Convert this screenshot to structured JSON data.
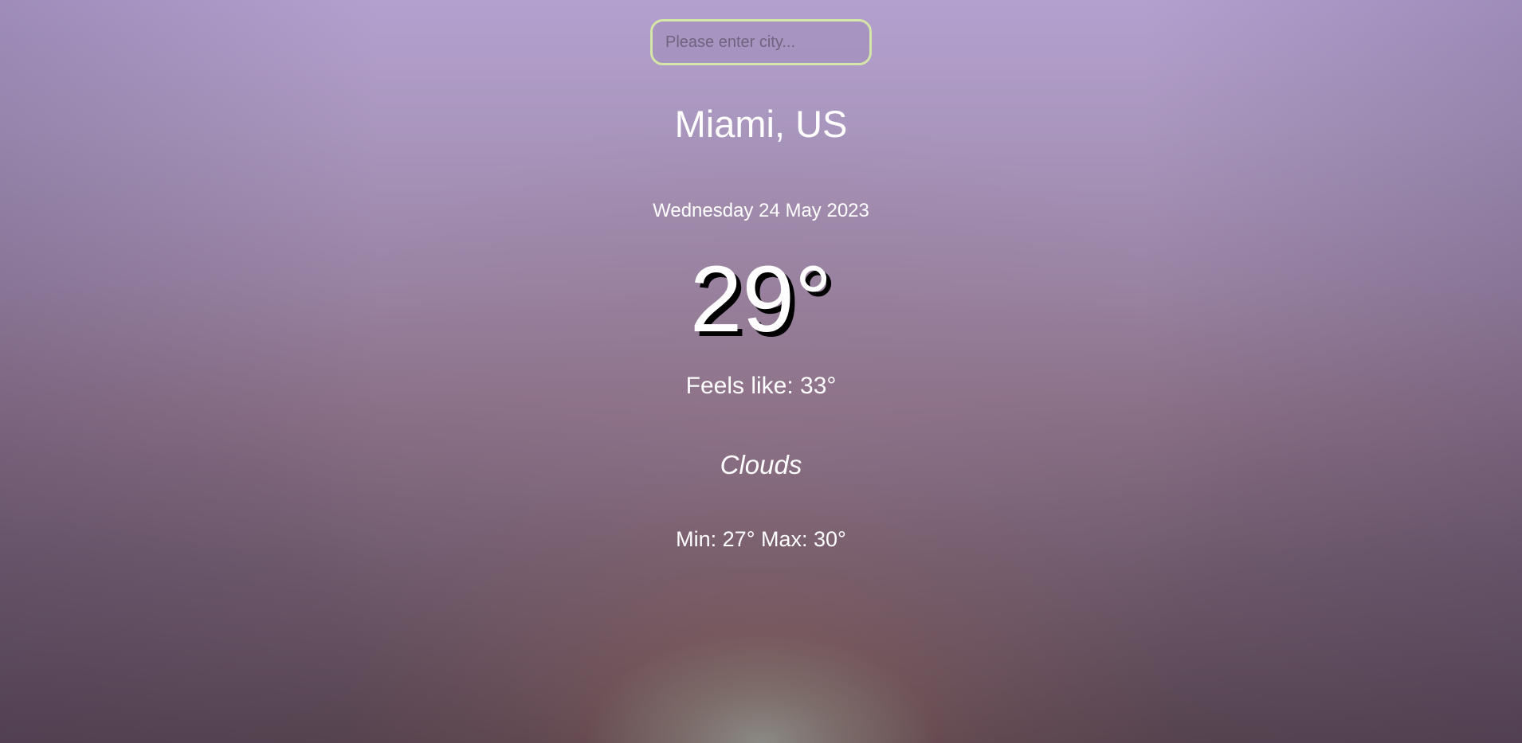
{
  "search": {
    "placeholder": "Please enter city...",
    "value": ""
  },
  "weather": {
    "location": "Miami, US",
    "date": "Wednesday 24 May 2023",
    "temperature": "29°",
    "feels_like": "Feels like: 33°",
    "description": "Clouds",
    "min_max": "Min: 27° Max: 30°"
  },
  "colors": {
    "input_border": "#d4e6a8",
    "text": "#ffffff",
    "temp_shadow": "#000000"
  }
}
